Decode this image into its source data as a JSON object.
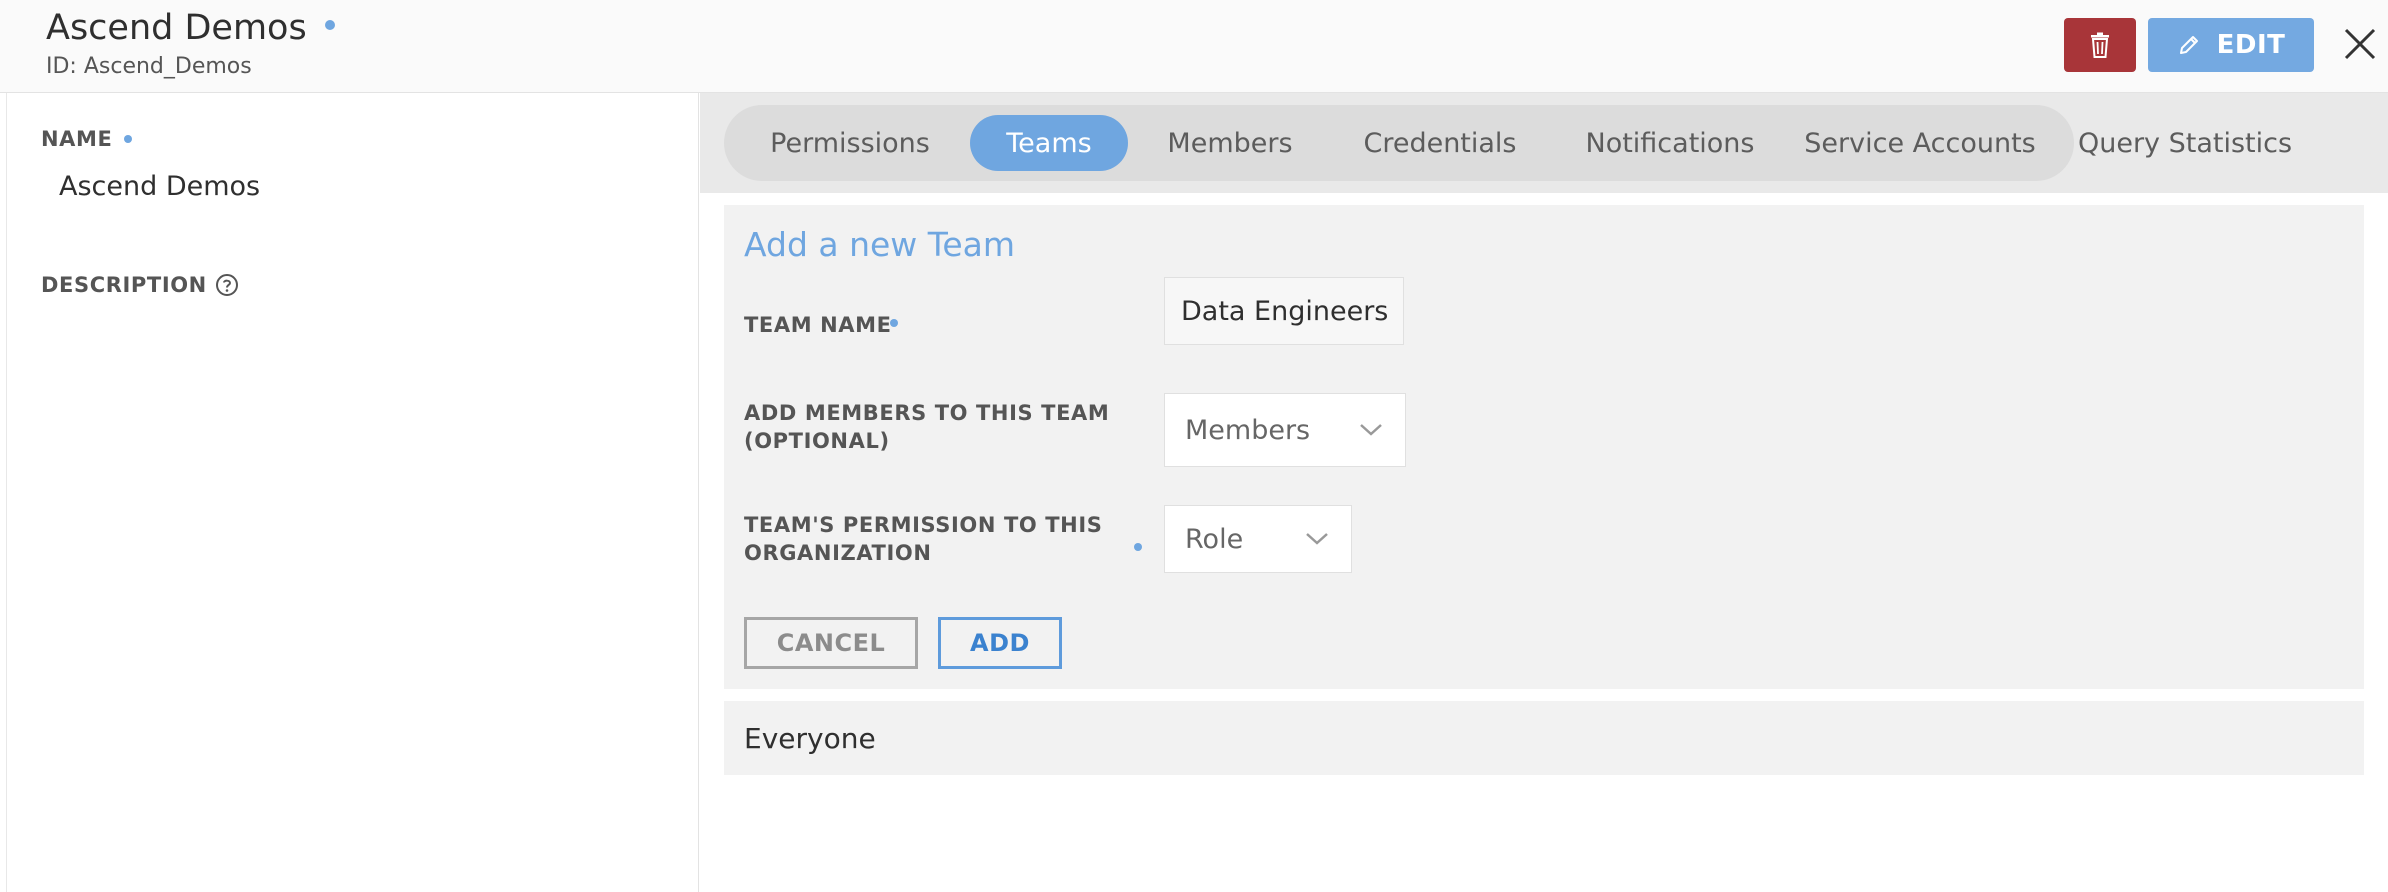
{
  "header": {
    "title": "Ascend Demos",
    "subtitle": "ID: Ascend_Demos",
    "edit_label": "EDIT",
    "delete_icon": "trash-icon",
    "close_icon": "close-icon"
  },
  "left": {
    "name_label": "NAME",
    "name_value": "Ascend Demos",
    "description_label": "DESCRIPTION"
  },
  "tabs": [
    {
      "label": "Permissions",
      "active": false
    },
    {
      "label": "Teams",
      "active": true
    },
    {
      "label": "Members",
      "active": false
    },
    {
      "label": "Credentials",
      "active": false
    },
    {
      "label": "Notifications",
      "active": false
    },
    {
      "label": "Service Accounts",
      "active": false
    },
    {
      "label": "Query Statistics",
      "active": false
    }
  ],
  "add_team": {
    "title": "Add a new Team",
    "team_name_label": "TEAM NAME",
    "team_name_value": "Data Engineers",
    "members_label_line1": "ADD MEMBERS TO THIS TEAM",
    "members_label_line2": "(OPTIONAL)",
    "members_placeholder": "Members",
    "permission_label_line1": "TEAM'S PERMISSION TO THIS",
    "permission_label_line2": "ORGANIZATION",
    "role_placeholder": "Role",
    "cancel_label": "CANCEL",
    "add_label": "ADD"
  },
  "teams": [
    {
      "name": "Everyone"
    }
  ],
  "colors": {
    "accent": "#6fa6e0",
    "danger": "#a83539"
  }
}
